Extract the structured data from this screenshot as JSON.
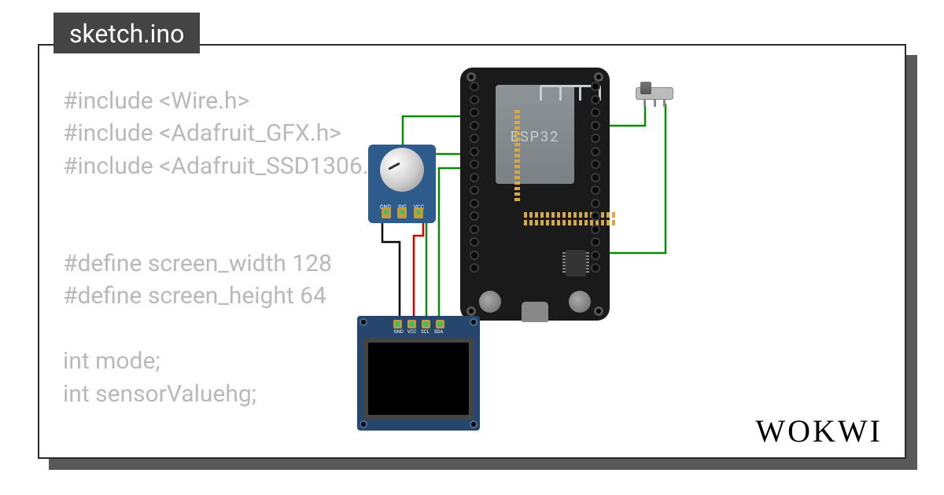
{
  "tab": {
    "filename": "sketch.ino"
  },
  "code": {
    "line1": "#include <Wire.h>",
    "line2": "#include <Adafruit_GFX.h>",
    "line3": "#include <Adafruit_SSD1306.h>",
    "line4": "",
    "line5": "",
    "line6": "#define screen_width 128",
    "line7": "#define screen_height 64",
    "line8": "",
    "line9": "int mode;",
    "line10": "int sensorValuehg;"
  },
  "branding": {
    "name": "WOKWI"
  },
  "components": {
    "esp32": {
      "label": "ESP32"
    },
    "potentiometer": {
      "pins": [
        "GND",
        "SIG",
        "VCC"
      ]
    },
    "oled": {
      "pins": [
        "GND",
        "VCC",
        "SCL",
        "SDA"
      ]
    },
    "switch": {
      "name": "slide-switch"
    }
  },
  "wires": [
    {
      "color": "#008800",
      "from": "pot.SIG",
      "to": "esp32.left"
    },
    {
      "color": "#008800",
      "from": "esp32.right",
      "to": "switch.1"
    },
    {
      "color": "#008800",
      "from": "switch.3",
      "to": "esp32.right"
    },
    {
      "color": "#008800",
      "from": "oled.SCL",
      "to": "esp32.left"
    },
    {
      "color": "#008800",
      "from": "oled.SDA",
      "to": "esp32.left"
    },
    {
      "color": "#d40000",
      "from": "pot.VCC",
      "to": "oled.VCC"
    },
    {
      "color": "#000000",
      "from": "pot.GND",
      "to": "oled.GND"
    }
  ]
}
